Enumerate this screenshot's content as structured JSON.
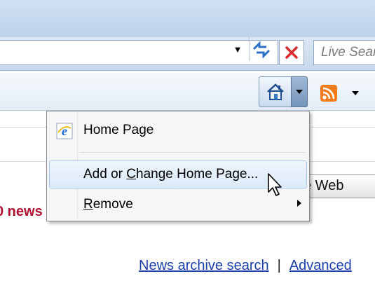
{
  "search": {
    "placeholder": "Live Search"
  },
  "menu": {
    "items": [
      {
        "label": "Home Page",
        "icon": "ie-icon"
      },
      {
        "label_prefix": "Add or ",
        "label_underline": "C",
        "label_suffix": "hange Home Page...",
        "hovered": true
      },
      {
        "label_prefix": "",
        "label_underline": "R",
        "label_suffix": "emove",
        "has_submenu": true
      }
    ]
  },
  "page": {
    "news_text": "0 news",
    "search_web_label": "e Web",
    "links": {
      "news_archive": "News archive search",
      "separator": "|",
      "advanced": "Advanced"
    }
  },
  "colors": {
    "chrome": "#c7d9ec",
    "menu_hover": "#dbe9f8",
    "news_red": "#b01030",
    "link_blue": "#1a3fa8",
    "stop_red": "#d92b2b",
    "feed_orange": "#f07c1c"
  }
}
